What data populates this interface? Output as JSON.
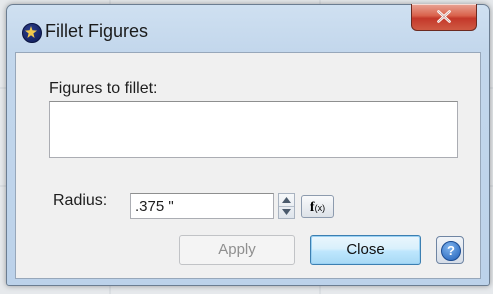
{
  "window": {
    "title": "Fillet Figures",
    "close_symbol": "x",
    "app_icon": "star-compass-icon"
  },
  "figures": {
    "label": "Figures to fillet:",
    "items": []
  },
  "radius": {
    "label": "Radius:",
    "value": ".375 \""
  },
  "fx_button": {
    "main": "f",
    "sub": "(x)"
  },
  "buttons": {
    "apply_label": "Apply",
    "apply_enabled": false,
    "close_label": "Close",
    "help_symbol": "?"
  },
  "colors": {
    "close_accent": "#c4382a",
    "title_bar": "#c3d7ec",
    "focus_blue": "#3c7fb1"
  }
}
